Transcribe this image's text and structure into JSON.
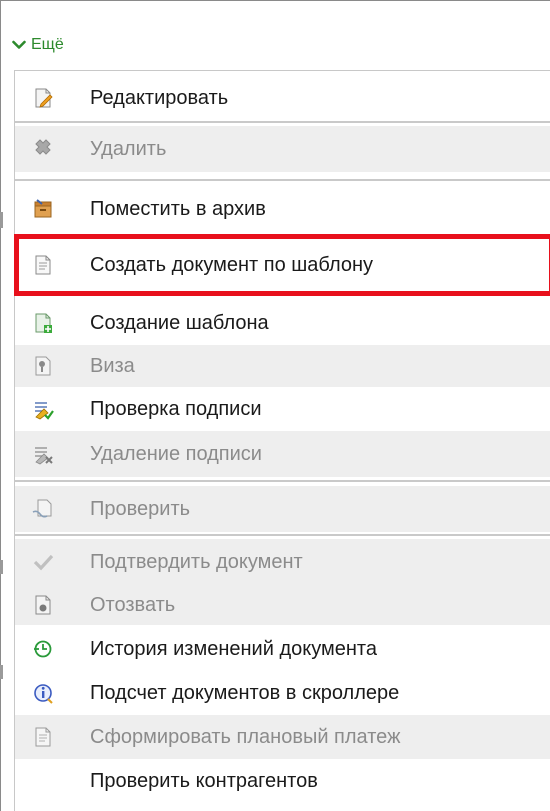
{
  "more_label": "Ещё",
  "colors": {
    "accent_green": "#2d8a2d",
    "highlight_red": "#e8101c",
    "disabled_bg": "#eeeeee"
  },
  "menu": {
    "items": [
      {
        "label": "Редактировать",
        "icon": "edit-document-icon",
        "enabled": true
      },
      {
        "label": "Удалить",
        "icon": "delete-x-icon",
        "enabled": false
      },
      {
        "label": "Поместить в архив",
        "icon": "archive-box-icon",
        "enabled": true
      },
      {
        "label": "Создать документ по шаблону",
        "icon": "document-template-icon",
        "enabled": true,
        "highlighted": true
      },
      {
        "label": "Создание шаблона",
        "icon": "create-template-icon",
        "enabled": true
      },
      {
        "label": "Виза",
        "icon": "visa-stamp-icon",
        "enabled": false
      },
      {
        "label": "Проверка подписи",
        "icon": "signature-check-icon",
        "enabled": true
      },
      {
        "label": "Удаление подписи",
        "icon": "signature-delete-icon",
        "enabled": false
      },
      {
        "label": "Проверить",
        "icon": "document-check-icon",
        "enabled": false
      },
      {
        "label": "Подтвердить документ",
        "icon": "checkmark-icon",
        "enabled": false
      },
      {
        "label": "Отозвать",
        "icon": "revoke-document-icon",
        "enabled": false
      },
      {
        "label": "История изменений документа",
        "icon": "history-icon",
        "enabled": true
      },
      {
        "label": "Подсчет документов в скроллере",
        "icon": "info-icon",
        "enabled": true
      },
      {
        "label": "Сформировать плановый платеж",
        "icon": "payment-document-icon",
        "enabled": false
      },
      {
        "label": "Проверить контрагентов",
        "icon": "",
        "enabled": true
      }
    ]
  }
}
